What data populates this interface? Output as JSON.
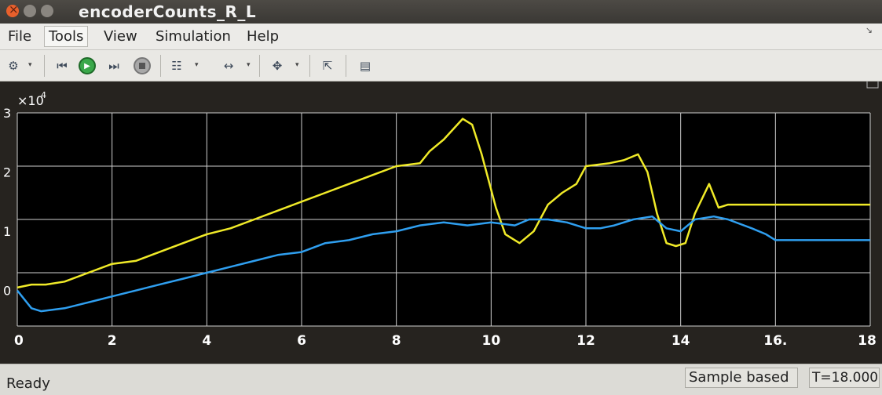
{
  "window": {
    "title": "encoderCounts_R_L"
  },
  "menubar": {
    "items": [
      {
        "label": "File",
        "name": "menu-file"
      },
      {
        "label": "Tools",
        "name": "menu-tools"
      },
      {
        "label": "View",
        "name": "menu-view"
      },
      {
        "label": "Simulation",
        "name": "menu-simulation"
      },
      {
        "label": "Help",
        "name": "menu-help"
      }
    ]
  },
  "toolbar": {
    "icons": [
      "gear-icon",
      "step-back-icon",
      "run-icon",
      "step-forward-icon",
      "stop-icon",
      "highlight-block-icon",
      "zoom-icon",
      "autoscale-icon",
      "restore-icon",
      "measurement-icon"
    ]
  },
  "scope": {
    "background": "#000000",
    "grid_color": "#cfcfcf",
    "axis_text_color": "#ffffff",
    "exponent_label": "×10",
    "exponent_power": "4"
  },
  "chart_data": {
    "type": "line",
    "xlim": [
      0,
      18
    ],
    "ylim": [
      -0.6,
      3
    ],
    "x_ticks": [
      "0",
      "2",
      "4",
      "6",
      "8",
      "10",
      "12",
      "14",
      "16.",
      "18"
    ],
    "y_ticks": [
      "3",
      "2",
      "1",
      "0"
    ],
    "grid": true,
    "series": [
      {
        "color": "#f0ea28",
        "points": [
          [
            0,
            0.05
          ],
          [
            0.3,
            0.1
          ],
          [
            0.6,
            0.1
          ],
          [
            1,
            0.15
          ],
          [
            1.5,
            0.3
          ],
          [
            2,
            0.45
          ],
          [
            2.5,
            0.5
          ],
          [
            3,
            0.65
          ],
          [
            3.5,
            0.8
          ],
          [
            4,
            0.95
          ],
          [
            4.5,
            1.05
          ],
          [
            5,
            1.2
          ],
          [
            5.5,
            1.35
          ],
          [
            6,
            1.5
          ],
          [
            6.5,
            1.65
          ],
          [
            7,
            1.8
          ],
          [
            7.5,
            1.95
          ],
          [
            8,
            2.1
          ],
          [
            8.5,
            2.15
          ],
          [
            8.7,
            2.35
          ],
          [
            9,
            2.55
          ],
          [
            9.4,
            2.9
          ],
          [
            9.6,
            2.8
          ],
          [
            9.8,
            2.3
          ],
          [
            10.1,
            1.4
          ],
          [
            10.3,
            0.95
          ],
          [
            10.6,
            0.8
          ],
          [
            10.9,
            1.0
          ],
          [
            11.2,
            1.45
          ],
          [
            11.5,
            1.65
          ],
          [
            11.8,
            1.8
          ],
          [
            12,
            2.1
          ],
          [
            12.5,
            2.15
          ],
          [
            12.8,
            2.2
          ],
          [
            13.1,
            2.3
          ],
          [
            13.3,
            2.0
          ],
          [
            13.5,
            1.3
          ],
          [
            13.7,
            0.8
          ],
          [
            13.9,
            0.75
          ],
          [
            14.1,
            0.8
          ],
          [
            14.3,
            1.3
          ],
          [
            14.6,
            1.8
          ],
          [
            14.8,
            1.4
          ],
          [
            15,
            1.45
          ],
          [
            16,
            1.45
          ],
          [
            17,
            1.45
          ],
          [
            18,
            1.45
          ]
        ]
      },
      {
        "color": "#2f9ff0",
        "points": [
          [
            0,
            0.0
          ],
          [
            0.3,
            -0.3
          ],
          [
            0.5,
            -0.35
          ],
          [
            1,
            -0.3
          ],
          [
            1.5,
            -0.2
          ],
          [
            2,
            -0.1
          ],
          [
            2.5,
            0.0
          ],
          [
            3,
            0.1
          ],
          [
            3.5,
            0.2
          ],
          [
            4,
            0.3
          ],
          [
            4.5,
            0.4
          ],
          [
            5,
            0.5
          ],
          [
            5.5,
            0.6
          ],
          [
            6,
            0.65
          ],
          [
            6.5,
            0.8
          ],
          [
            7,
            0.85
          ],
          [
            7.5,
            0.95
          ],
          [
            8,
            1.0
          ],
          [
            8.5,
            1.1
          ],
          [
            9,
            1.15
          ],
          [
            9.5,
            1.1
          ],
          [
            10,
            1.15
          ],
          [
            10.5,
            1.1
          ],
          [
            10.8,
            1.2
          ],
          [
            11.2,
            1.2
          ],
          [
            11.6,
            1.15
          ],
          [
            12,
            1.05
          ],
          [
            12.3,
            1.05
          ],
          [
            12.6,
            1.1
          ],
          [
            13,
            1.2
          ],
          [
            13.4,
            1.25
          ],
          [
            13.7,
            1.05
          ],
          [
            14,
            1.0
          ],
          [
            14.3,
            1.2
          ],
          [
            14.7,
            1.25
          ],
          [
            15,
            1.2
          ],
          [
            15.5,
            1.05
          ],
          [
            15.8,
            0.95
          ],
          [
            16,
            0.85
          ],
          [
            17,
            0.85
          ],
          [
            18,
            0.85
          ]
        ]
      }
    ]
  },
  "statusbar": {
    "ready": "Ready",
    "sample_mode": "Sample based",
    "time": "T=18.000"
  }
}
